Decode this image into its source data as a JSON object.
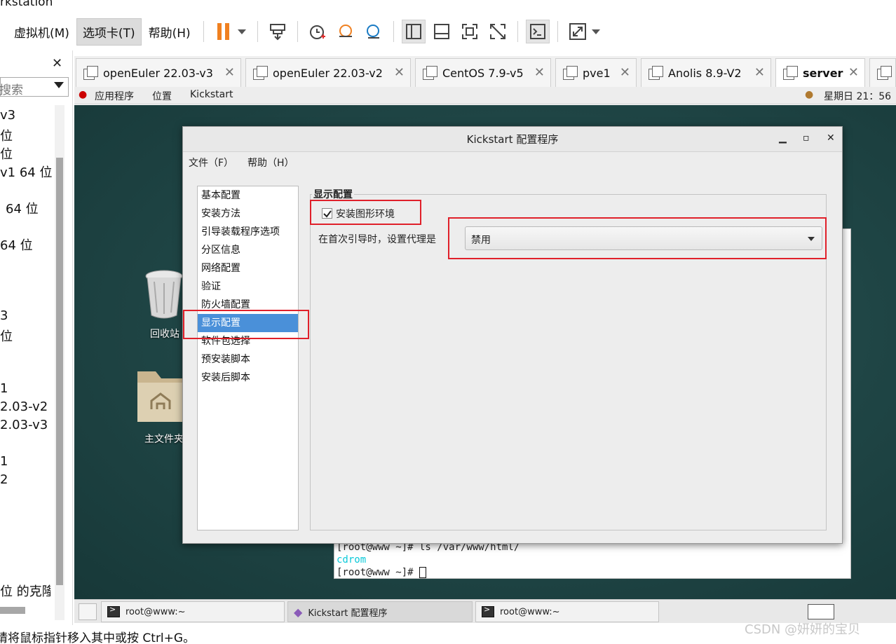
{
  "window_title": "rkstation",
  "menu": [
    "虚拟机(M)",
    "选项卡(T)",
    "帮助(H)"
  ],
  "library": {
    "search_placeholder": "搜索",
    "rows": [
      "v3",
      "位",
      "位",
      "v1 64 位",
      "64 位",
      "64 位",
      "3",
      "位",
      "1",
      "2.03-v2",
      "2.03-v3",
      "1",
      "2",
      "位 的克隆"
    ]
  },
  "tabs": [
    {
      "label": "openEuler 22.03-v3"
    },
    {
      "label": "openEuler 22.03-v2"
    },
    {
      "label": "CentOS 7.9-v5"
    },
    {
      "label": "pve1"
    },
    {
      "label": "Anolis 8.9-V2"
    },
    {
      "label": "server"
    }
  ],
  "gnome": {
    "apps": "应用程序",
    "places": "位置",
    "app_name": "Kickstart",
    "clock": "星期日 21：56"
  },
  "desktop": {
    "trash": "回收站",
    "home": "主文件夹"
  },
  "terminal": {
    "line1": "[root@www ~]# ls /var/www/html/",
    "line2": "cdrom",
    "line3": "[root@www ~]# "
  },
  "dialog": {
    "title": "Kickstart 配置程序",
    "menu_file": "文件（F）",
    "menu_help": "帮助（H）",
    "nav": [
      "基本配置",
      "安装方法",
      "引导装载程序选项",
      "分区信息",
      "网络配置",
      "验证",
      "防火墙配置",
      "显示配置",
      "软件包选择",
      "预安装脚本",
      "安装后脚本"
    ],
    "selected_nav": "显示配置",
    "panel_title": "显示配置",
    "checkbox_label": "安装图形环境",
    "checkbox_checked": true,
    "proxy_label": "在首次引导时，设置代理是",
    "proxy_value": "禁用"
  },
  "taskbar": [
    {
      "label": "root@www:~"
    },
    {
      "label": "Kickstart 配置程序"
    },
    {
      "label": "root@www:~"
    }
  ],
  "status_text": "请将鼠标指针移入其中或按 Ctrl+G。",
  "watermark": "CSDN @妍妍的宝贝",
  "colors": {
    "selection": "#4a90d9",
    "highlight_box": "#e0202a",
    "pause_icon": "#f08020"
  }
}
